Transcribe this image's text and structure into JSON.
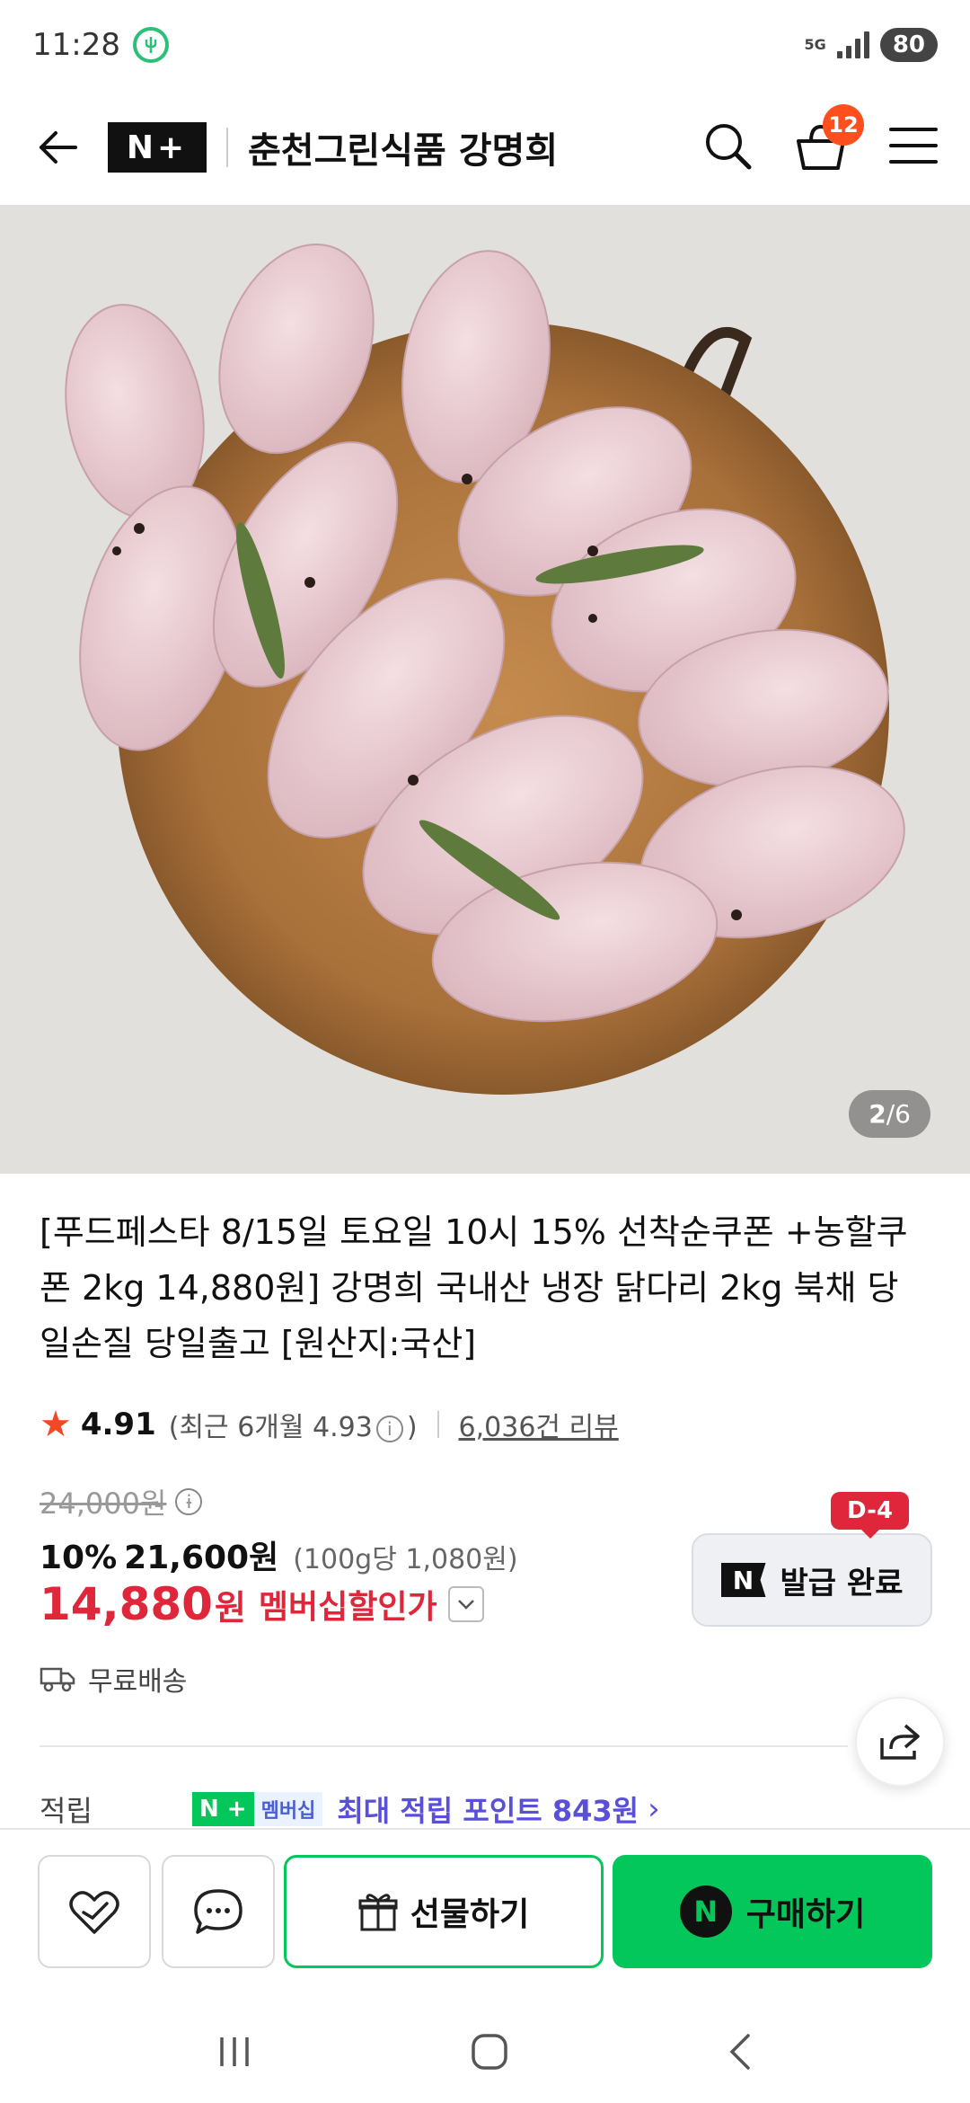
{
  "status_bar": {
    "time": "11:28",
    "network": "5G",
    "battery": "80",
    "icons": [
      "app-notification-icon",
      "signal-icon",
      "battery-icon"
    ]
  },
  "header": {
    "logo": "N+",
    "store_name": "춘천그린식품 강명희",
    "cart_count": "12",
    "icons": [
      "back-arrow-icon",
      "search-icon",
      "cart-icon",
      "menu-icon"
    ]
  },
  "gallery": {
    "current": "2",
    "separator": "/",
    "total": "6"
  },
  "product": {
    "title": "[푸드페스타 8/15일 토요일 10시 15% 선착순쿠폰 +농할쿠폰 2kg 14,880원] 강명희 국내산 냉장 닭다리 2kg 북채 당일손질 당일출고 [원산지:국산]",
    "rating": "4.91",
    "recent_rating_prefix": "(최근 6개월 4.93",
    "recent_rating_suffix": ")",
    "review_count": "6,036건 리뷰",
    "original_price": "24,000원",
    "discount_rate": "10%",
    "discount_price": "21,600원",
    "unit_price": "(100g당 1,080원)",
    "member_price": "14,880",
    "member_price_unit": "원",
    "member_label": "멤버십할인가",
    "shipping": "무료배송"
  },
  "coupon": {
    "dday": "D-4",
    "icon_letter": "N",
    "label": "발급 완료"
  },
  "points": {
    "label": "적립",
    "badge_n": "N +",
    "badge_membership": "멤버십",
    "text": "최대 적립 포인트 843원",
    "chevron": "›"
  },
  "bottom_bar": {
    "gift_label": "선물하기",
    "buy_icon_letter": "N",
    "buy_label": "구매하기"
  },
  "colors": {
    "naver_green": "#03c75a",
    "price_red": "#e0263a",
    "points_purple": "#5a4fd8",
    "cart_badge": "#ff4f1f"
  }
}
